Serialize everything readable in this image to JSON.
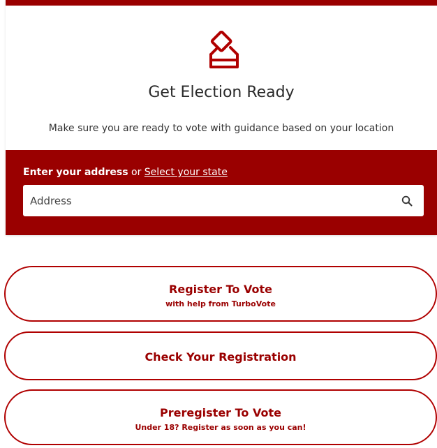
{
  "header": {
    "title": "Get Election Ready",
    "subtitle": "Make sure you are ready to vote with guidance based on your location",
    "icon": "ballot-box-icon"
  },
  "address_panel": {
    "label_strong": "Enter your address",
    "label_or": "or",
    "select_state_link": "Select your state",
    "input_placeholder": "Address",
    "input_value": ""
  },
  "actions": [
    {
      "title": "Register To Vote",
      "subtitle": "with help from TurboVote"
    },
    {
      "title": "Check Your Registration",
      "subtitle": ""
    },
    {
      "title": "Preregister To Vote",
      "subtitle": "Under 18? Register as soon as you can!"
    }
  ],
  "colors": {
    "brand": "#9a0000",
    "background": "#ffffff",
    "text": "#2a2a2a"
  }
}
